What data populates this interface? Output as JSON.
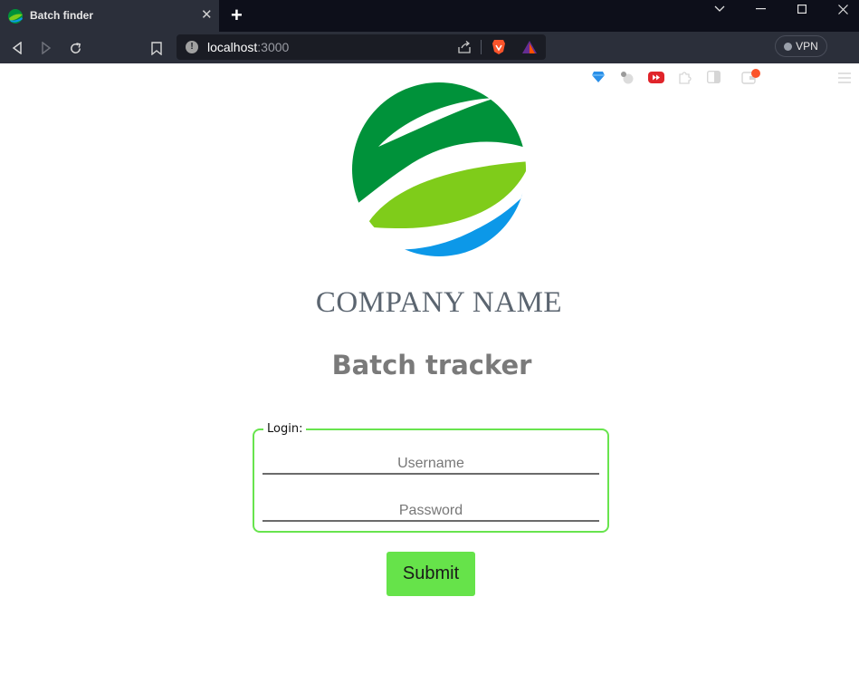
{
  "browser": {
    "tab_title": "Batch finder",
    "tab_close": "✕",
    "new_tab": "+",
    "url_host": "localhost",
    "url_port": ":3000",
    "vpn_label": "VPN",
    "info_glyph": "!"
  },
  "page": {
    "company_name": "COMPANY NAME",
    "heading": "Batch tracker",
    "form": {
      "legend": "Login:",
      "username_placeholder": "Username",
      "username_value": "",
      "password_placeholder": "Password",
      "password_value": "",
      "submit_label": "Submit"
    }
  },
  "colors": {
    "accent_green": "#68e44e",
    "logo_dark_green": "#00923a",
    "logo_light_green": "#7fcc1a",
    "logo_blue": "#0c98e8"
  },
  "icons": [
    "back-icon",
    "forward-icon",
    "reload-icon",
    "bookmark-icon",
    "info-icon",
    "share-icon",
    "brave-shield-icon",
    "brave-rewards-icon",
    "diamond-extension-icon",
    "ball-extension-icon",
    "video-extension-icon",
    "extensions-icon",
    "sidebar-icon",
    "wallet-icon",
    "menu-icon"
  ]
}
